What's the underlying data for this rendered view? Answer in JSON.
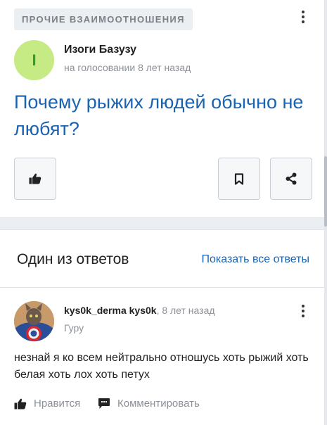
{
  "question": {
    "category": "ПРОЧИЕ ВЗАИМООТНОШЕНИЯ",
    "avatar_letter": "I",
    "author": "Изоги Базузу",
    "meta": "на голосовании 8 лет назад",
    "title": "Почему рыжих людей обычно не любят?",
    "actions": [
      "thumbs-up-icon",
      "bookmark-icon",
      "share-icon"
    ]
  },
  "answers": {
    "header": "Один из ответов",
    "show_all": "Показать все ответы",
    "item": {
      "author": "kys0k_derma kys0k",
      "time": ", 8 лет назад",
      "rank": "Гуру",
      "text": "незнай я ко всем нейтрально отношусь хоть рыжий хоть белая хоть лох хоть петух",
      "like_label": "Нравится",
      "comment_label": "Комментировать"
    }
  },
  "colors": {
    "link": "#1a63b0",
    "avatar_bg": "#c6ea84",
    "avatar_letter": "#2f9e2f",
    "muted": "#8c9097"
  }
}
